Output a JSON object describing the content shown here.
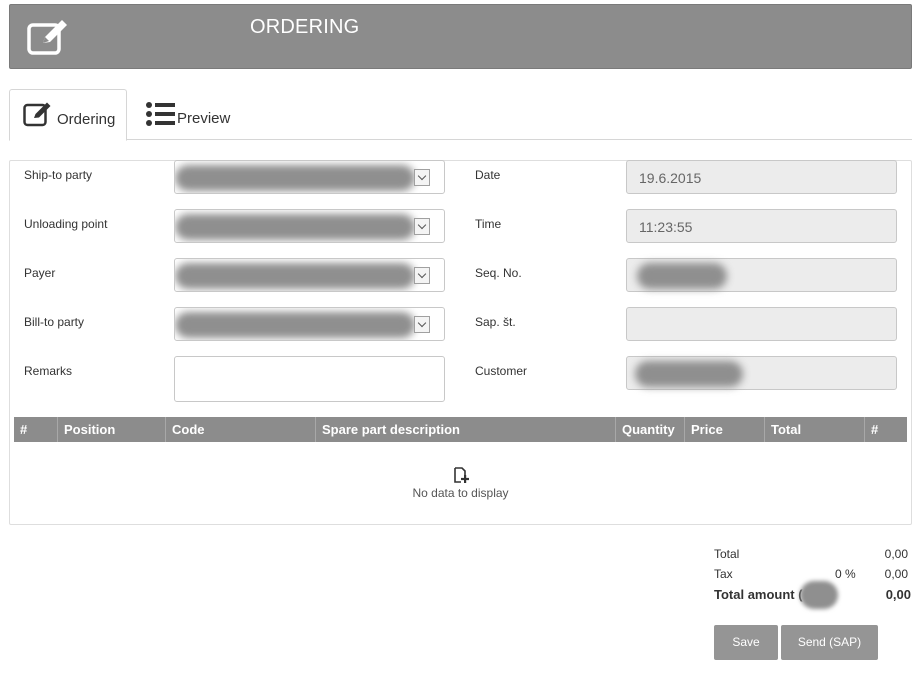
{
  "header": {
    "title": "ORDERING",
    "icon": "edit-icon"
  },
  "tabs": [
    {
      "label": "Ordering",
      "icon": "edit-icon",
      "active": true
    },
    {
      "label": "Preview",
      "icon": "list-icon",
      "active": false
    }
  ],
  "form": {
    "left": [
      {
        "label": "Ship-to party"
      },
      {
        "label": "Unloading point"
      },
      {
        "label": "Payer"
      },
      {
        "label": "Bill-to party"
      },
      {
        "label": "Remarks"
      }
    ],
    "right": [
      {
        "label": "Date",
        "value": "19.6.2015"
      },
      {
        "label": "Time",
        "value": "11:23:55"
      },
      {
        "label": "Seq. No.",
        "value": ""
      },
      {
        "label": "Sap. št.",
        "value": ""
      },
      {
        "label": "Customer",
        "value": ""
      }
    ]
  },
  "grid": {
    "columns": [
      "#",
      "Position",
      "Code",
      "Spare part description",
      "Quantity",
      "Price",
      "Total",
      "#"
    ],
    "empty_message": "No data to display",
    "empty_icon": "add-file-icon"
  },
  "summary": {
    "total_label": "Total",
    "total_value": "0,00",
    "tax_label": "Tax",
    "tax_percent": "0 %",
    "tax_value": "0,00",
    "total_amount_label": "Total amount (",
    "total_amount_value": "0,00"
  },
  "buttons": {
    "save": "Save",
    "send": "Send (SAP)"
  },
  "colors": {
    "header_bg": "#8c8c8c",
    "button_bg": "#959595"
  }
}
